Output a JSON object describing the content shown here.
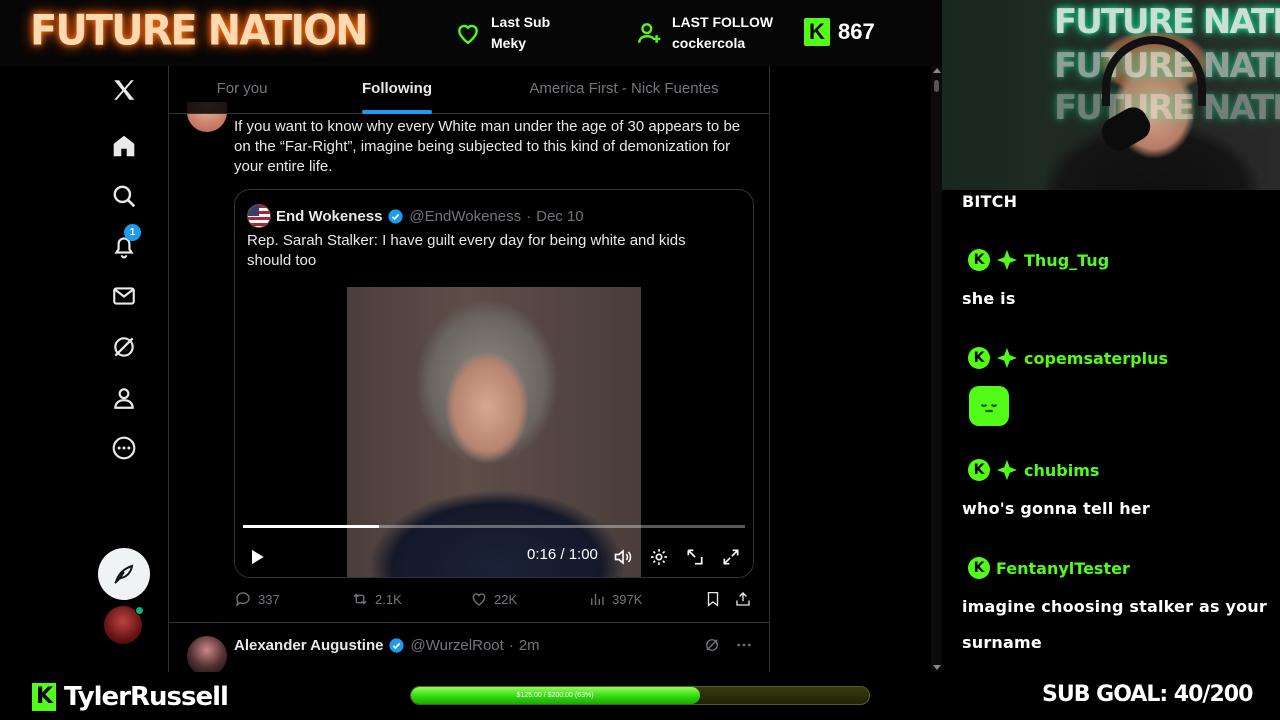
{
  "overlay": {
    "brand": "FUTURE NATION",
    "last_sub_label": "Last Sub",
    "last_sub_name": "Meky",
    "last_follow_label": "LAST FOLLOW",
    "last_follow_name": "cockercola",
    "kick_letter": "K",
    "viewer_count": "867",
    "accent": "#53fc18"
  },
  "nav": {
    "notification_count": "1"
  },
  "tabs": [
    {
      "label": "For you"
    },
    {
      "label": "Following"
    },
    {
      "label": "America First - Nick Fuentes"
    }
  ],
  "post": {
    "text": "If you want to know why every White man under the age of 30 appears to be on the “Far-Right”, imagine being subjected to this kind of demonization for your entire life.",
    "quote": {
      "name": "End Wokeness",
      "handle": "@EndWokeness",
      "sep": "·",
      "date": "Dec 10",
      "text": "Rep. Sarah Stalker: I have guilt every day for being white and kids should too",
      "video_time": "0:16 / 1:00",
      "video_progress": 0.27
    },
    "stats": {
      "replies": "337",
      "reposts": "2.1K",
      "likes": "22K",
      "views": "397K"
    }
  },
  "next_post": {
    "name": "Alexander Augustine",
    "handle": "@WurzelRoot",
    "sep": "·",
    "time": "2m"
  },
  "webcam": {
    "neon_text": "FUTURE NATION",
    "neon_text_2": "FUTURE NATION",
    "neon_text_3": "FUTURE NATION"
  },
  "chat": {
    "top_message": "BITCH",
    "messages": [
      {
        "user": "Thug_Tug",
        "text": "she is"
      },
      {
        "user": "copemsaterplus",
        "text": ""
      },
      {
        "user": "chubims",
        "text": "who's gonna tell her"
      },
      {
        "user": "FentanylTester",
        "text": "imagine choosing stalker as your",
        "text_2": "surname"
      }
    ]
  },
  "bottom": {
    "streamer": "TylerRussell",
    "goal_text": "$125.00 / $200.00 (63%)",
    "goal_progress": 0.63,
    "goal_label": "SUB GOAL: 40/200"
  }
}
